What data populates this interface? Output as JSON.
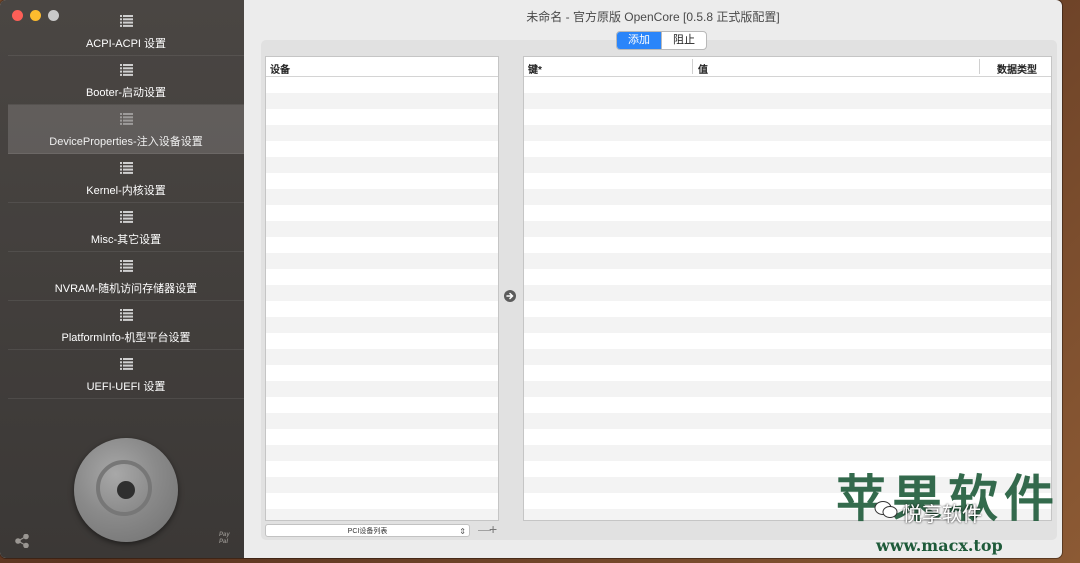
{
  "window": {
    "title": "未命名 - 官方原版 OpenCore [0.5.8 正式版配置]"
  },
  "sidebar": {
    "items": [
      {
        "label": "ACPI-ACPI 设置",
        "active": false
      },
      {
        "label": "Booter-启动设置",
        "active": false
      },
      {
        "label": "DeviceProperties-注入设备设置",
        "active": true
      },
      {
        "label": "Kernel-内核设置",
        "active": false
      },
      {
        "label": "Misc-其它设置",
        "active": false
      },
      {
        "label": "NVRAM-随机访问存储器设置",
        "active": false
      },
      {
        "label": "PlatformInfo-机型平台设置",
        "active": false
      },
      {
        "label": "UEFI-UEFI 设置",
        "active": false
      }
    ],
    "item_icon": "list-icon",
    "paypal_line1": "Pay",
    "paypal_line2": "Pal"
  },
  "segments": {
    "add": "添加",
    "block": "阻止",
    "selected": "add"
  },
  "devices_table": {
    "header": "设备"
  },
  "props_table": {
    "col_key": "键*",
    "col_value": "值",
    "col_type": "数据类型"
  },
  "footer": {
    "select_value": "PCI设备列表",
    "minus": "—",
    "plus": "+"
  },
  "watermark": {
    "big_text": "苹果软件",
    "brand": "悦享软件",
    "url": "www.macx.top"
  },
  "colors": {
    "accent": "#2a85fa",
    "sidebar": "#403d3b",
    "watermark": "#1f5b3a"
  }
}
